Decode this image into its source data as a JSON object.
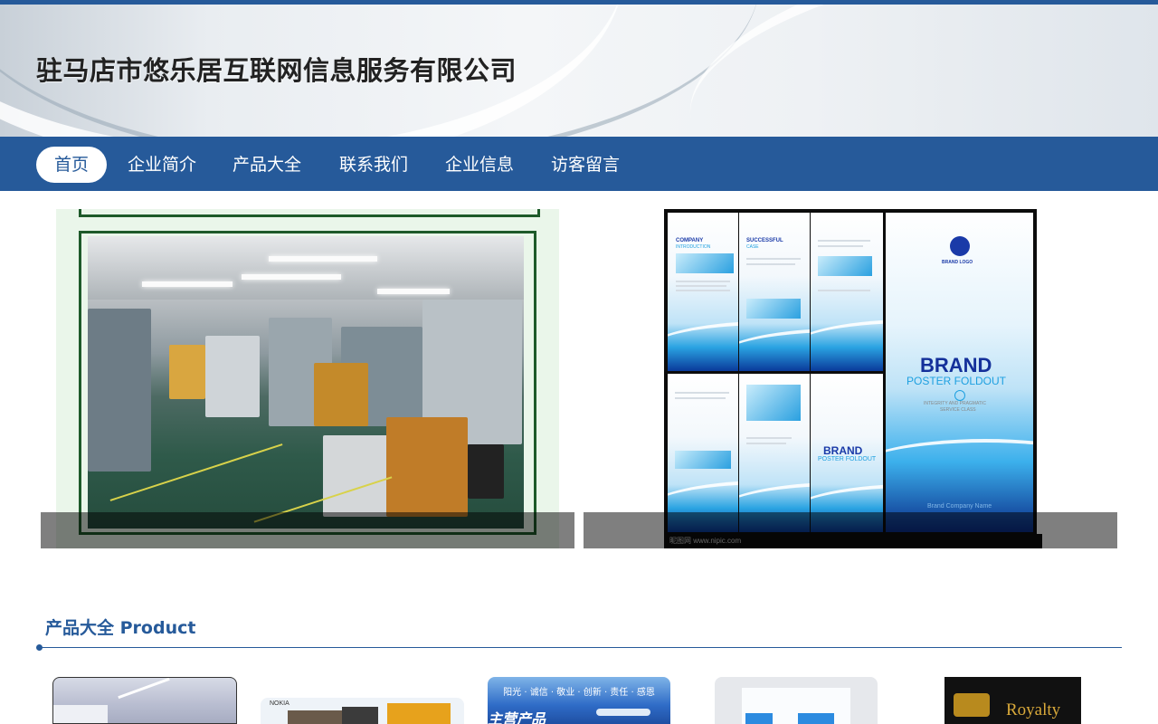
{
  "company": {
    "name": "驻马店市悠乐居互联网信息服务有限公司"
  },
  "nav": {
    "items": [
      {
        "label": "首页",
        "active": true
      },
      {
        "label": "企业简介"
      },
      {
        "label": "产品大全"
      },
      {
        "label": "联系我们"
      },
      {
        "label": "企业信息"
      },
      {
        "label": "访客留言"
      }
    ]
  },
  "banners": {
    "right": {
      "headings": [
        "COMPANY",
        "SUCCESSFUL"
      ],
      "subheadings": [
        "INTRODUCTION",
        "CASE"
      ],
      "brand_logo": "BRAND LOGO",
      "brand": "BRAND",
      "poster": "POSTER FOLDOUT",
      "tagline_1": "INTEGRITY AND PRAGMATIC",
      "tagline_2": "SERVICE CLASS",
      "small_brand": "BRAND",
      "small_poster": "POSTER FOLDOUT",
      "watermark": "昵图网 www.nipic.com",
      "company_name": "Brand Company Name"
    }
  },
  "products": {
    "title": "产品大全 Product",
    "thumb_texts": {
      "nokia": "NOKIA",
      "blue_top": "阳光 · 诚信 · 敬业 · 创新 · 责任 · 感恩",
      "blue_main": "主营产品",
      "royalty": "Royalty"
    }
  },
  "colors": {
    "primary": "#265a9a",
    "white": "#ffffff"
  }
}
